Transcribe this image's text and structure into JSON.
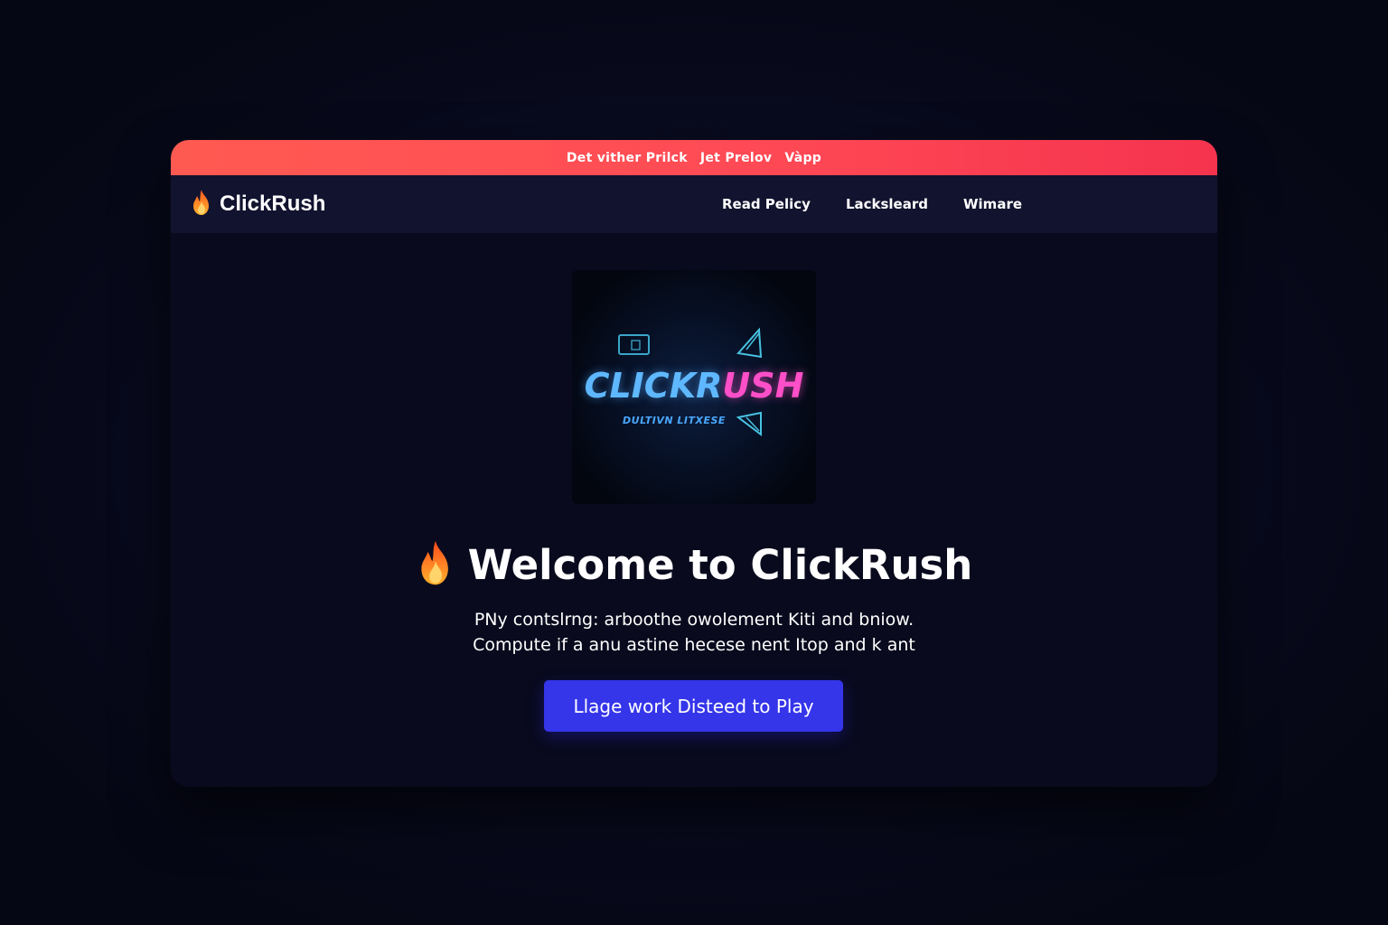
{
  "promo_bar": {
    "items": [
      "Det vither Prilck",
      "Jet Preloᴠ",
      "Vàpp"
    ],
    "color": "#ff4a55"
  },
  "navbar": {
    "brand_icon": "fire-icon",
    "brand_title": "ClickRush",
    "links": [
      "Read Pelicy",
      "Lacksleard",
      "Wimare"
    ]
  },
  "hero_image": {
    "logo_word_1": "CLICKR",
    "logo_word_2": "USH",
    "tagline": "DULTIVN LITXESE",
    "icons": [
      "card-icon",
      "arrow-icon",
      "arrow-icon"
    ]
  },
  "hero": {
    "headline_icon": "fire-icon",
    "headline": "Welcome to ClickRush",
    "description_line_1": "PNy contslrng: arboothe owolement  Kiti and bniow.",
    "description_line_2": "Compute if a anu astine hecese nent  Itop and k ant",
    "cta_label": "Llage work Disteed to Play",
    "cta_color": "#3535ea"
  }
}
